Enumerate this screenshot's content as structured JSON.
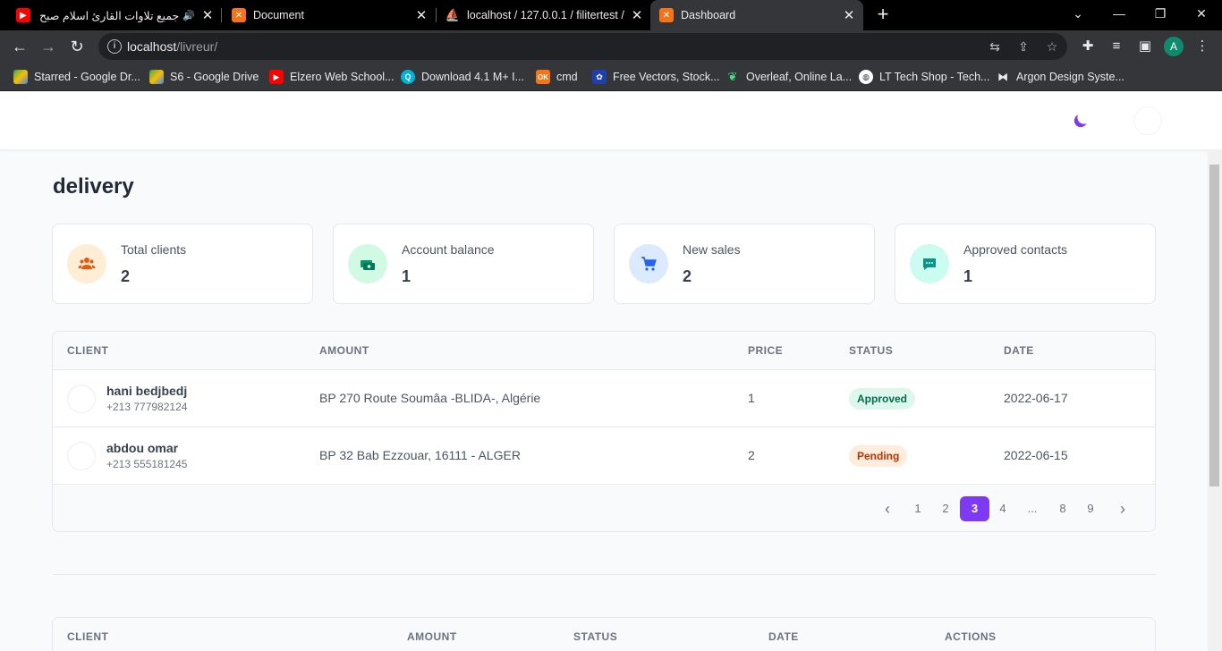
{
  "browser": {
    "tabs": [
      {
        "title": "جميع تلاوات القارئ اسلام صبح",
        "icon": "youtube-icon"
      },
      {
        "title": "Document",
        "icon": "xampp-icon"
      },
      {
        "title": "localhost / 127.0.0.1 / filitertest /",
        "icon": "phpmyadmin-icon"
      },
      {
        "title": "Dashboard",
        "icon": "xampp-icon"
      }
    ],
    "url_host": "localhost",
    "url_path": "/livreur/",
    "profile_initial": "A",
    "bookmarks": [
      {
        "label": "Starred - Google Dr...",
        "icon": "google-drive-icon"
      },
      {
        "label": "S6 - Google Drive",
        "icon": "google-drive-icon"
      },
      {
        "label": "Elzero Web School...",
        "icon": "youtube-icon"
      },
      {
        "label": "Download 4.1 M+ I...",
        "icon": "search-icon"
      },
      {
        "label": "cmd",
        "icon": "ok-icon"
      },
      {
        "label": "Free Vectors, Stock...",
        "icon": "freepik-icon"
      },
      {
        "label": "Overleaf, Online La...",
        "icon": "overleaf-icon"
      },
      {
        "label": "LT Tech Shop - Tech...",
        "icon": "globe-icon"
      },
      {
        "label": "Argon Design Syste...",
        "icon": "argon-icon"
      }
    ]
  },
  "page": {
    "title": "delivery",
    "cards": [
      {
        "label": "Total clients",
        "value": "2",
        "icon": "users-icon",
        "color": "#ea580c",
        "bg": "#ffedd5"
      },
      {
        "label": "Account balance",
        "value": "1",
        "icon": "cash-icon",
        "color": "#059669",
        "bg": "#d1fae5"
      },
      {
        "label": "New sales",
        "value": "2",
        "icon": "cart-icon",
        "color": "#2563eb",
        "bg": "#dbeafe"
      },
      {
        "label": "Approved contacts",
        "value": "1",
        "icon": "chat-icon",
        "color": "#0d9488",
        "bg": "#ccfbf1"
      }
    ],
    "table": {
      "headers": [
        "CLIENT",
        "AMOUNT",
        "PRICE",
        "STATUS",
        "DATE"
      ],
      "rows": [
        {
          "name": "hani bedjbedj",
          "phone": "+213 777982124",
          "amount": "BP 270 Route Soumâa -BLIDA-, Algérie",
          "price": "1",
          "status": "Approved",
          "date": "2022-06-17"
        },
        {
          "name": "abdou omar",
          "phone": "+213 555181245",
          "amount": "BP 32 Bab Ezzouar, 16111 - ALGER",
          "price": "2",
          "status": "Pending",
          "date": "2022-06-15"
        }
      ],
      "pagination": {
        "pages": [
          "1",
          "2",
          "3",
          "4",
          "...",
          "8",
          "9"
        ],
        "active": "3",
        "prev": "‹",
        "next": "›"
      }
    },
    "table2": {
      "headers": [
        "CLIENT",
        "AMOUNT",
        "STATUS",
        "DATE",
        "ACTIONS"
      ]
    },
    "colors": {
      "accent": "#7e3af2",
      "approved_bg": "#def7ec",
      "approved_fg": "#046c4e",
      "pending_bg": "#feecdc",
      "pending_fg": "#b43403"
    }
  }
}
